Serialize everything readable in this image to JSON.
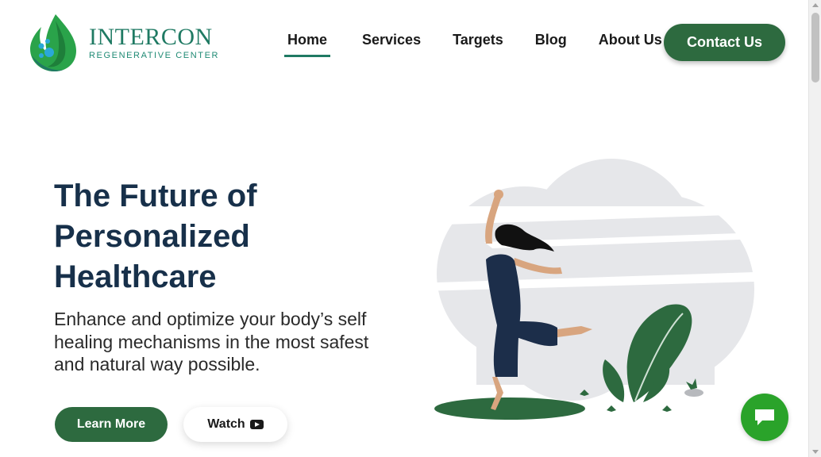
{
  "brand": {
    "name": "INTERCON",
    "tagline": "REGENERATIVE CENTER",
    "colors": {
      "primary": "#2d6a3f",
      "accent": "#1f7a63",
      "heading": "#17304a",
      "chat": "#2aa32a"
    }
  },
  "nav": {
    "items": [
      {
        "label": "Home",
        "active": true
      },
      {
        "label": "Services",
        "active": false
      },
      {
        "label": "Targets",
        "active": false
      },
      {
        "label": "Blog",
        "active": false
      },
      {
        "label": "About Us",
        "active": false
      }
    ],
    "contact_label": "Contact Us"
  },
  "hero": {
    "title_lines": [
      "The Future of",
      "Personalized",
      "Healthcare"
    ],
    "subtitle_lines": [
      "Enhance and optimize your body’s self",
      "healing mechanisms in the most safest",
      "and natural way possible."
    ],
    "learn_label": "Learn More",
    "watch_label": "Watch",
    "watch_icon": "youtube-play-icon"
  },
  "chat": {
    "icon": "chat-bubble-icon"
  }
}
